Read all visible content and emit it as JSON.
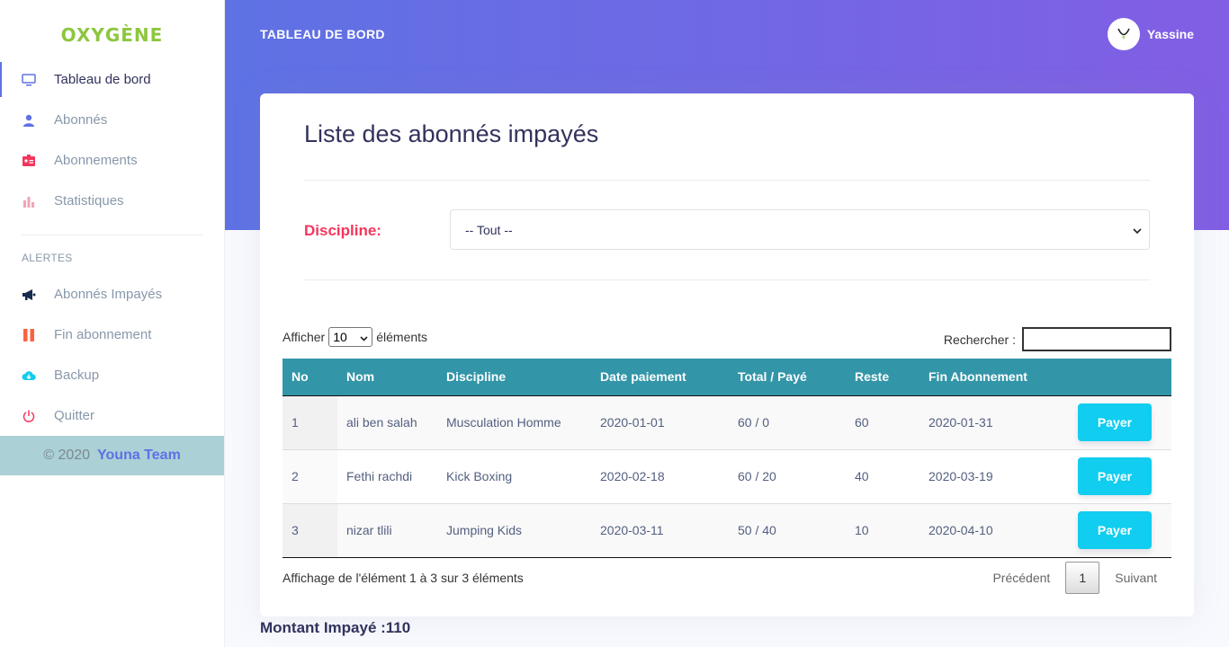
{
  "brand": {
    "logo_text": "OXYGÈNE",
    "footer_year": "© 2020",
    "footer_team": "Youna Team"
  },
  "sidebar": {
    "items": [
      {
        "label": "Tableau de bord",
        "icon": "monitor-icon",
        "color": "#5e72e4"
      },
      {
        "label": "Abonnés",
        "icon": "user-icon",
        "color": "#5e72e4"
      },
      {
        "label": "Abonnements",
        "icon": "id-card-icon",
        "color": "#f5365c"
      },
      {
        "label": "Statistiques",
        "icon": "bar-chart-icon",
        "color": "#f3a4b5"
      }
    ],
    "alerts_heading": "ALERTES",
    "alert_items": [
      {
        "label": "Abonnés Impayés",
        "icon": "megaphone-icon",
        "color": "#172b4d"
      },
      {
        "label": "Fin abonnement",
        "icon": "pause-icon",
        "color": "#fb6340"
      },
      {
        "label": "Backup",
        "icon": "cloud-download-icon",
        "color": "#11cdef"
      },
      {
        "label": "Quitter",
        "icon": "power-icon",
        "color": "#f5365c"
      }
    ]
  },
  "header": {
    "title": "TABLEAU DE BORD",
    "user_name": "Yassine"
  },
  "card": {
    "title": "Liste des abonnés impayés",
    "discipline_label": "Discipline:",
    "discipline_value": "-- Tout --",
    "show_prefix": "Afficher",
    "page_length": "10",
    "show_suffix": "éléments",
    "search_label": "Rechercher :",
    "search_value": ""
  },
  "table": {
    "columns": [
      "No",
      "Nom",
      "Discipline",
      "Date paiement",
      "Total / Payé",
      "Reste",
      "Fin Abonnement",
      ""
    ],
    "rows": [
      {
        "no": "1",
        "nom": "ali ben salah",
        "discipline": "Musculation Homme",
        "date": "2020-01-01",
        "total": "60 / 0",
        "reste": "60",
        "fin": "2020-01-31",
        "action": "Payer"
      },
      {
        "no": "2",
        "nom": "Fethi rachdi",
        "discipline": "Kick Boxing",
        "date": "2020-02-18",
        "total": "60 / 20",
        "reste": "40",
        "fin": "2020-03-19",
        "action": "Payer"
      },
      {
        "no": "3",
        "nom": "nizar tlili",
        "discipline": "Jumping Kids",
        "date": "2020-03-11",
        "total": "50 / 40",
        "reste": "10",
        "fin": "2020-04-10",
        "action": "Payer"
      }
    ]
  },
  "footer_info": "Affichage de l'élément 1 à 3 sur 3 éléments",
  "pagination": {
    "prev": "Précédent",
    "current": "1",
    "next": "Suivant"
  },
  "total_unpaid": "Montant Impayé :110",
  "colors": {
    "header_start": "#5e72e4",
    "header_end": "#825ee4",
    "table_header": "#3395a8",
    "pay_button": "#11cdef",
    "discipline_label": "#f5365c"
  }
}
